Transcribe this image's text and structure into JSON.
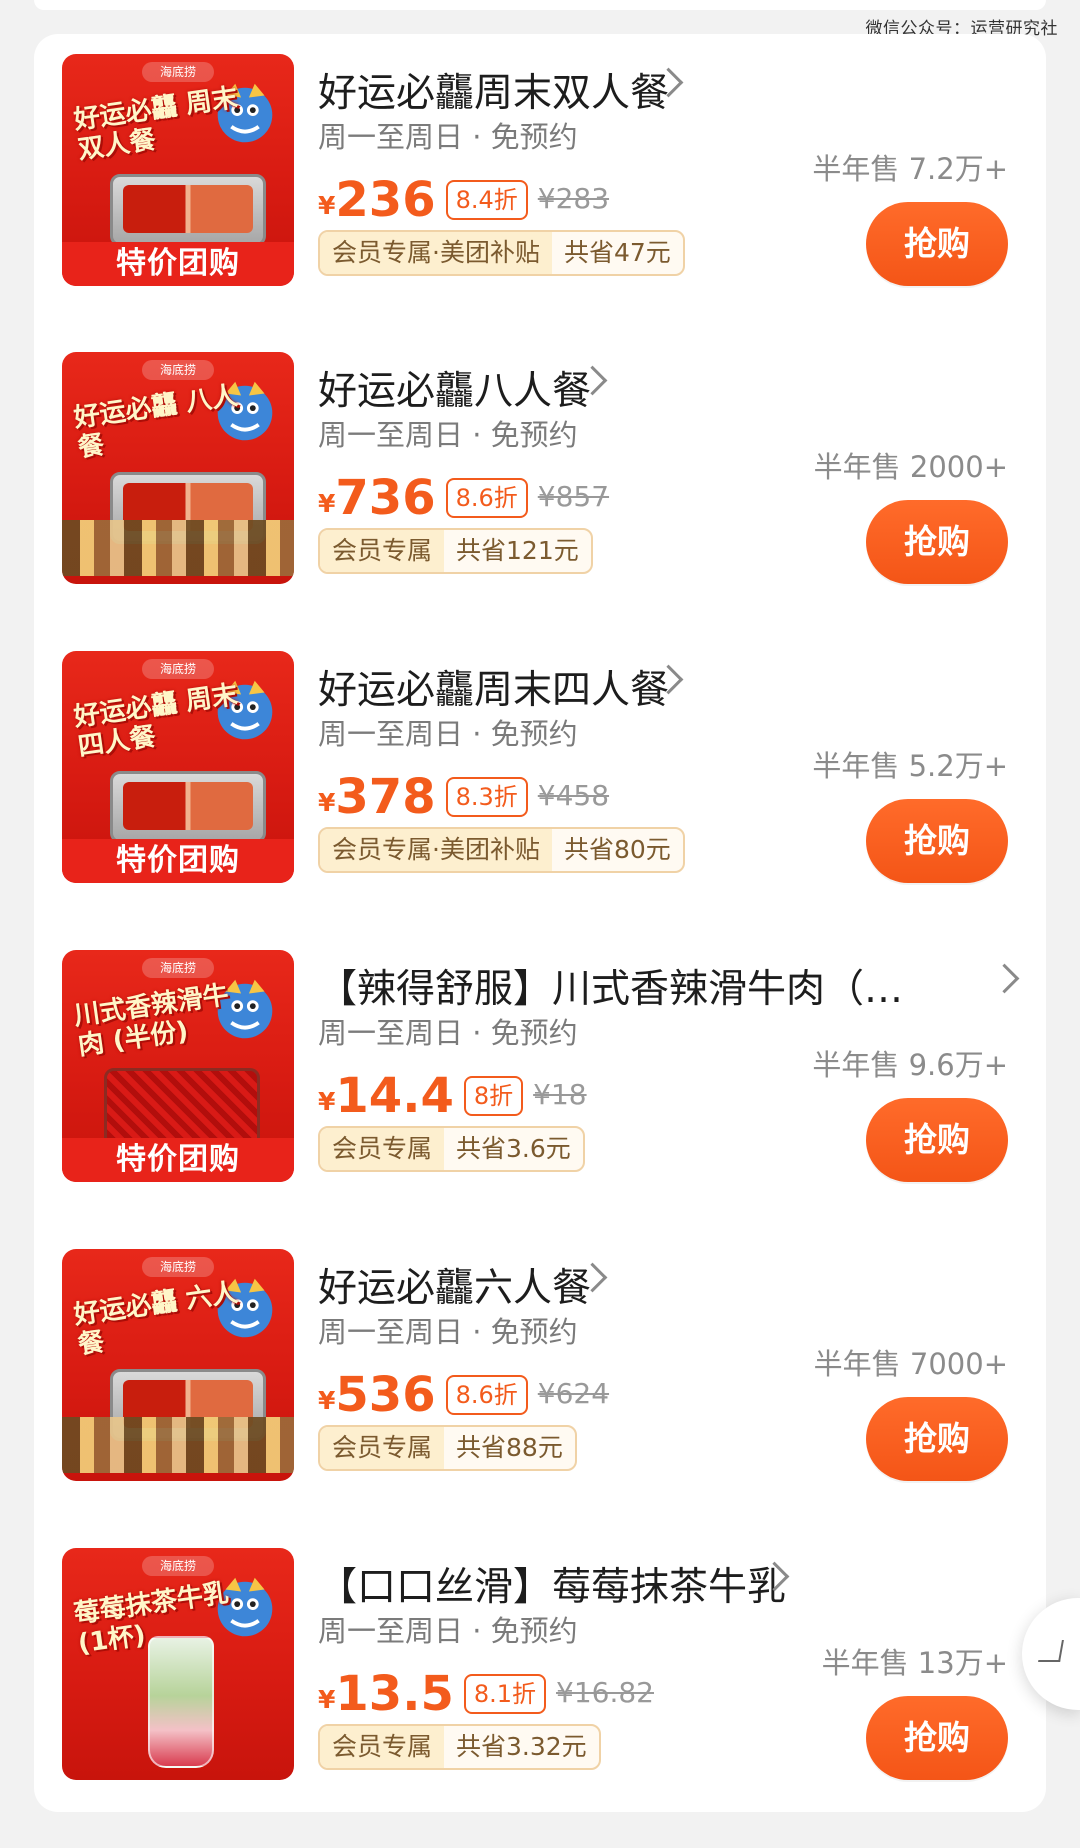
{
  "watermark": "微信公众号：运营研究社",
  "items": [
    {
      "title": "好运必龘周末双人餐",
      "sub": "周一至周日 · 免预约",
      "sold": "半年售 7.2万+",
      "yen": "¥",
      "price": "236",
      "discount": "8.4折",
      "original": "¥283",
      "member_tag": "会员专属·美团补贴",
      "save": "共省47元",
      "buy": "抢购",
      "thumb": {
        "logo": "海底捞",
        "title": "好运必龘 周末双人餐",
        "band": "特价团购"
      }
    },
    {
      "title": "好运必龘八人餐",
      "sub": "周一至周日 · 免预约",
      "sold": "半年售 2000+",
      "yen": "¥",
      "price": "736",
      "discount": "8.6折",
      "original": "¥857",
      "member_tag": "会员专属",
      "save": "共省121元",
      "buy": "抢购",
      "thumb": {
        "logo": "海底捞",
        "title": "好运必龘 八人餐"
      }
    },
    {
      "title": "好运必龘周末四人餐",
      "sub": "周一至周日 · 免预约",
      "sold": "半年售 5.2万+",
      "yen": "¥",
      "price": "378",
      "discount": "8.3折",
      "original": "¥458",
      "member_tag": "会员专属·美团补贴",
      "save": "共省80元",
      "buy": "抢购",
      "thumb": {
        "logo": "海底捞",
        "title": "好运必龘 周末四人餐",
        "band": "特价团购"
      }
    },
    {
      "title": "【辣得舒服】川式香辣滑牛肉（…",
      "sub": "周一至周日 · 免预约",
      "sold": "半年售 9.6万+",
      "yen": "¥",
      "price": "14.4",
      "discount": "8折",
      "original": "¥18",
      "member_tag": "会员专属",
      "save": "共省3.6元",
      "buy": "抢购",
      "thumb": {
        "logo": "海底捞",
        "title": "川式香辣滑牛肉 (半份)",
        "band": "特价团购"
      }
    },
    {
      "title": "好运必龘六人餐",
      "sub": "周一至周日 · 免预约",
      "sold": "半年售 7000+",
      "yen": "¥",
      "price": "536",
      "discount": "8.6折",
      "original": "¥624",
      "member_tag": "会员专属",
      "save": "共省88元",
      "buy": "抢购",
      "thumb": {
        "logo": "海底捞",
        "title": "好运必龘 六人餐"
      }
    },
    {
      "title": "【口口丝滑】莓莓抹茶牛乳",
      "sub": "周一至周日 · 免预约",
      "sold": "半年售 13万+",
      "yen": "¥",
      "price": "13.5",
      "discount": "8.1折",
      "original": "¥16.82",
      "member_tag": "会员专属",
      "save": "共省3.32元",
      "buy": "抢购",
      "thumb": {
        "logo": "海底捞",
        "title": "莓莓抹茶牛乳 (1杯)"
      }
    }
  ],
  "colors": {
    "accent": "#f35b1c",
    "button": "#f45517",
    "page_bg": "#f2f2f2"
  },
  "icons": {
    "chevron": "chevron-right-icon",
    "cart": "cart-icon"
  }
}
